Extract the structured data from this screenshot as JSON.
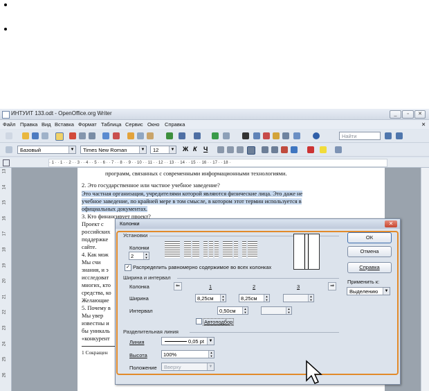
{
  "window": {
    "title": "ИНТУИТ 133.odt - OpenOffice.org Writer",
    "menu": [
      "Файл",
      "Правка",
      "Вид",
      "Вставка",
      "Формат",
      "Таблица",
      "Сервис",
      "Окно",
      "Справка"
    ],
    "find_placeholder": "Найти",
    "style_value": "Базовый",
    "font_value": "Times New Roman",
    "size_value": "12",
    "format_buttons": [
      "Ж",
      "К",
      "Ч"
    ],
    "ruler_ticks": "· 1 · · 1 · · 2 · · 3 · · 4 · · 5 · · 6 · · 7 · · 8 · · 9 · · 10 · · 11 · · 12 · · 13 · · 14 · · 15 · · 16 · · 17 · · 18 ·",
    "vruler": [
      "13",
      "14",
      "15",
      "16",
      "17",
      "18",
      "19",
      "20",
      "21",
      "22",
      "23",
      "24",
      "25",
      "26"
    ]
  },
  "document": {
    "lines": [
      "программ, связанных с современными информационными технологиями.",
      "2.  Это государственное или частное учебное заведение?",
      "    Это частная организация, учредителями которой являются физические лица. Это даже не",
      "учебное заведение, по крайней мере в том смысле, в котором этот термин используется в",
      "официальных документах.",
      "3.  Кто финансирует проект?",
      "    Проект с",
      "российских",
      "поддержке",
      "сайте.",
      "4.  Как мож",
      "    Мы счи",
      "знания, и э",
      "исследоват",
      "многих, кто",
      "средства, ко",
      "Желающие",
      "5.  Почему в",
      "    Мы увер",
      "известны и",
      "бы уникаль",
      "«конкурент",
      "1  Сокращен"
    ]
  },
  "dialog": {
    "title": "Колонки",
    "settings_group": "Установки",
    "columns_label": "Колонки",
    "columns_value": "2",
    "distribute_label": "Распределить равномерно содержимое во всех колонках",
    "width_spacing_group": "Ширина и интервал",
    "column_label": "Колонка",
    "col_numbers": [
      "1",
      "2",
      "3"
    ],
    "width_label": "Ширина",
    "width_values": [
      "8,25см",
      "8,25см",
      ""
    ],
    "spacing_label": "Интервал",
    "spacing_values": [
      "0,50см",
      ""
    ],
    "autofit_label": "Автоподбор",
    "separator_group": "Разделительная линия",
    "line_label": "Линия",
    "line_value": "0,05 pt",
    "height_label": "Высота",
    "height_value": "100%",
    "position_label": "Положение",
    "position_value": "Вверху",
    "ok": "ОК",
    "cancel": "Отмена",
    "help": "Справка",
    "apply_to_label": "Применить к:",
    "apply_to_value": "Выделению"
  }
}
